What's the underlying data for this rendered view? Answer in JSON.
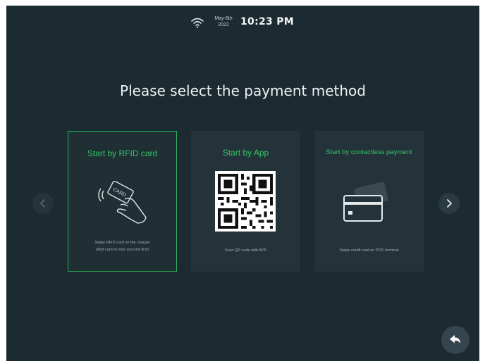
{
  "status": {
    "wifi_icon": "wifi-icon",
    "date_line1": "May-6th",
    "date_line2": "2022",
    "time": "10:23 PM"
  },
  "title": "Please select the payment method",
  "nav": {
    "prev_icon": "chevron-left-icon",
    "next_icon": "chevron-right-icon"
  },
  "cards": [
    {
      "title": "Start by RFID card",
      "icon": "rfid-card-tap-icon",
      "card_label": "CARD",
      "desc_line1": "Swipe RFID card on the charger",
      "desc_line2": "(Add card to your account first)",
      "selected": true
    },
    {
      "title": "Start by App",
      "icon": "qr-code-icon",
      "desc_line1": "Scan QR code with APP",
      "selected": false
    },
    {
      "title": "Start by contactless payment",
      "icon": "credit-card-icon",
      "desc_line1": "Swipe credit card on POS terminal",
      "selected": false
    }
  ],
  "back_icon": "back-arrow-icon",
  "colors": {
    "background": "#1c2a31",
    "card": "#243339",
    "accent_green": "#34c466",
    "selected_border": "#27b35a"
  }
}
